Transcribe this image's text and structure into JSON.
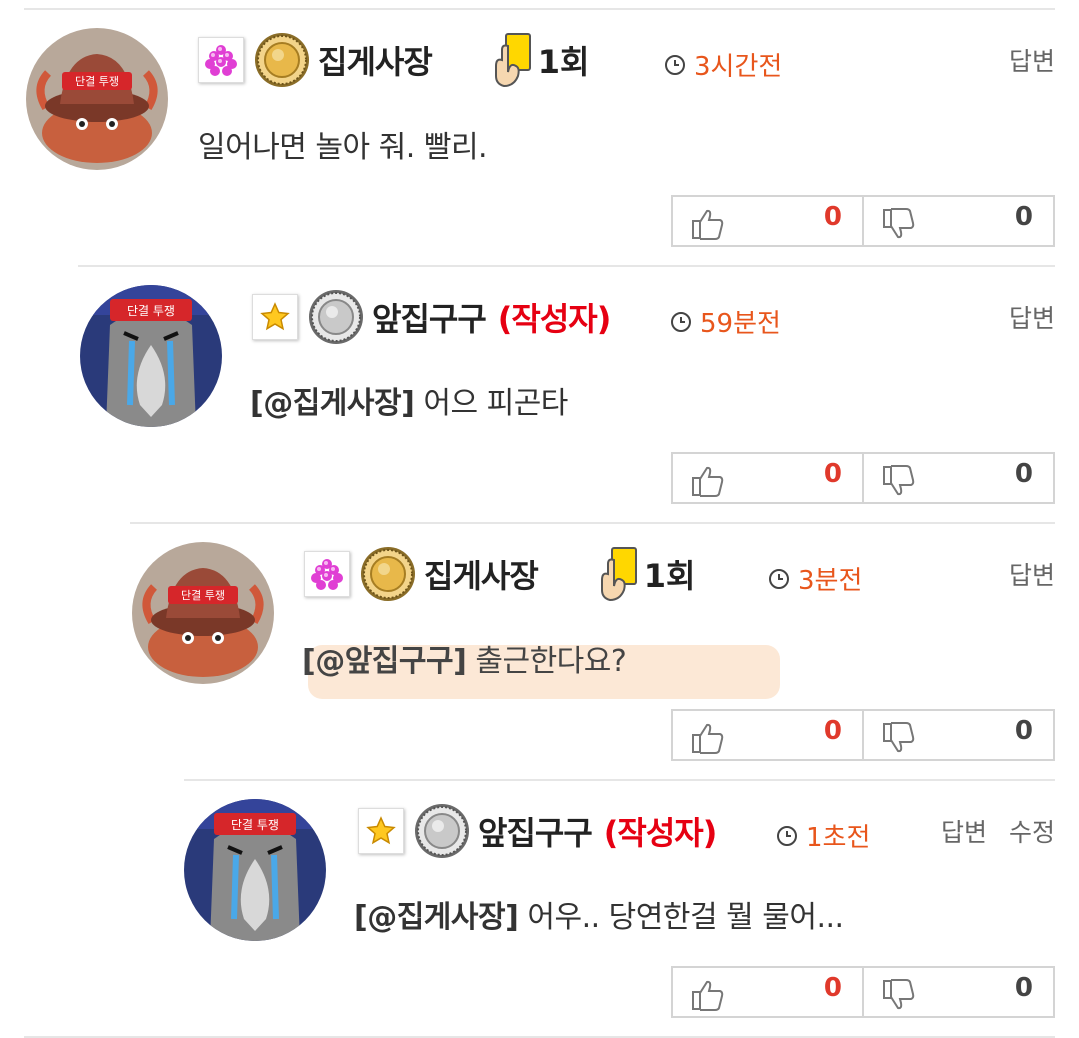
{
  "comments": [
    {
      "nickname": "집게사장",
      "author_label": "",
      "card_count": "1회",
      "time": "3시간전",
      "actions": [
        "답변"
      ],
      "mention": "",
      "text": "일어나면 놀아 줘. 빨리.",
      "votes": {
        "up": "0",
        "down": "0"
      },
      "level_icon": "flower-cluster-icon",
      "medal": "gold-medal-icon"
    },
    {
      "nickname": "앞집구구",
      "author_label": "(작성자)",
      "card_count": "",
      "time": "59분전",
      "actions": [
        "답변"
      ],
      "mention": "[@집게사장]",
      "text": " 어으 피곤타",
      "votes": {
        "up": "0",
        "down": "0"
      },
      "level_icon": "star-icon",
      "medal": "silver-medal-icon"
    },
    {
      "nickname": "집게사장",
      "author_label": "",
      "card_count": "1회",
      "time": "3분전",
      "actions": [
        "답변"
      ],
      "mention": "[@앞집구구]",
      "text": " 출근한다요?",
      "votes": {
        "up": "0",
        "down": "0"
      },
      "level_icon": "flower-cluster-icon",
      "medal": "gold-medal-icon"
    },
    {
      "nickname": "앞집구구",
      "author_label": "(작성자)",
      "card_count": "",
      "time": "1초전",
      "actions": [
        "답변",
        "수정"
      ],
      "mention": "[@집게사장]",
      "text": " 어우.. 당연한걸 뭘 물어...",
      "votes": {
        "up": "0",
        "down": "0"
      },
      "level_icon": "star-icon",
      "medal": "silver-medal-icon"
    }
  ],
  "avatar_labels": {
    "crab_hat": "단결 투쟁",
    "penguin_band": "단결 투쟁"
  },
  "colors": {
    "time": "#e8561c",
    "author": "#e60012",
    "upvote_count": "#e0392b",
    "highlight": "#f9d5b4"
  }
}
